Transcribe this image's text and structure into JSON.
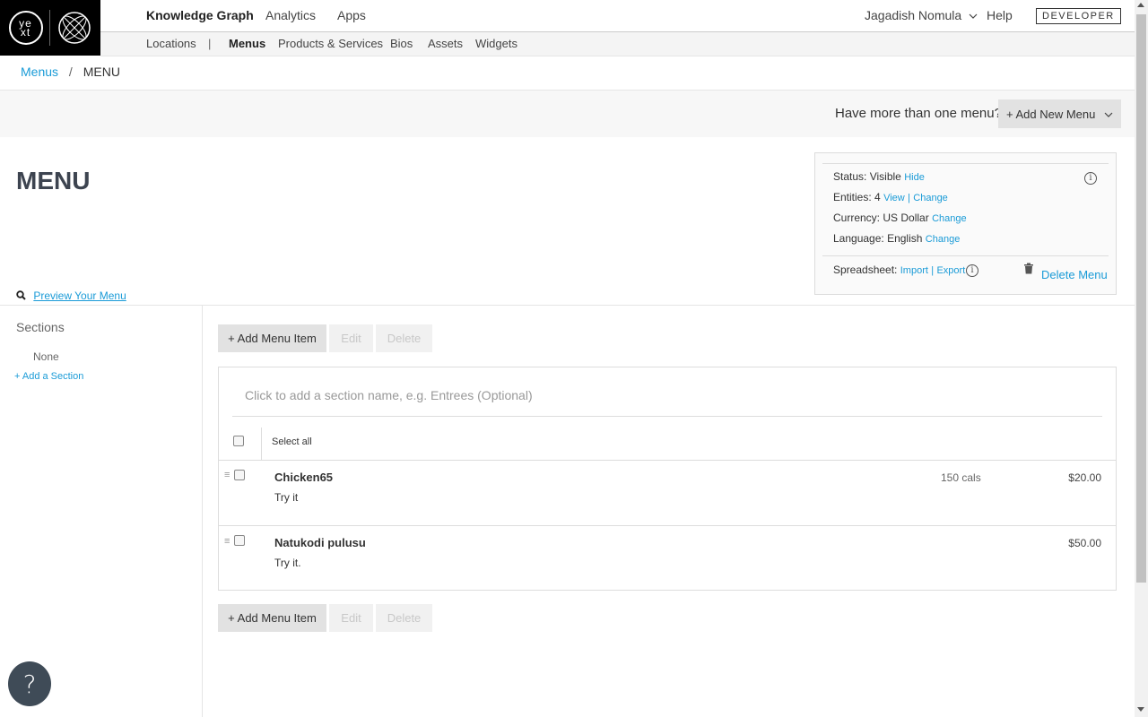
{
  "logo": {
    "text_top": "ye",
    "text_bottom": "xt"
  },
  "topnav": {
    "items": [
      {
        "label": "Knowledge Graph",
        "active": true
      },
      {
        "label": "Analytics"
      },
      {
        "label": "Apps"
      }
    ],
    "user": "Jagadish Nomula",
    "help": "Help",
    "developer": "DEVELOPER"
  },
  "subnav": {
    "items": [
      {
        "label": "Locations"
      },
      {
        "label": "Menus",
        "active": true
      },
      {
        "label": "Products & Services"
      },
      {
        "label": "Bios"
      },
      {
        "label": "Assets"
      },
      {
        "label": "Widgets"
      }
    ],
    "pipe": "|"
  },
  "breadcrumb": {
    "parent": "Menus",
    "separator": "/",
    "current": "MENU"
  },
  "band": {
    "question": "Have more than one menu?",
    "add_new": "+ Add New Menu"
  },
  "title": "MENU",
  "info": {
    "status_key": "Status:",
    "status_val": "Visible",
    "status_link": "Hide",
    "entities_key": "Entities:",
    "entities_val": "4",
    "entities_view": "View",
    "entities_change": "Change",
    "pipe": "|",
    "currency_key": "Currency:",
    "currency_val": "US Dollar",
    "currency_link": "Change",
    "language_key": "Language:",
    "language_val": "English",
    "language_link": "Change",
    "sheet_key": "Spreadsheet:",
    "sheet_import": "Import",
    "sheet_export": "Export",
    "delete_menu": "Delete Menu",
    "info_glyph": "i"
  },
  "preview": "Preview Your Menu",
  "sidebar": {
    "title": "Sections",
    "none": "None",
    "add": "+ Add a Section"
  },
  "actions": {
    "add_item": "+ Add Menu Item",
    "edit": "Edit",
    "delete": "Delete"
  },
  "menu": {
    "section_placeholder": "Click to add a section name, e.g. Entrees (Optional)",
    "select_all": "Select all",
    "items": [
      {
        "name": "Chicken65",
        "desc": "Try it",
        "cals": "150 cals",
        "price": "$20.00"
      },
      {
        "name": "Natukodi pulusu",
        "desc": "Try it.",
        "cals": "",
        "price": "$50.00"
      }
    ]
  },
  "help_bubble": "?"
}
